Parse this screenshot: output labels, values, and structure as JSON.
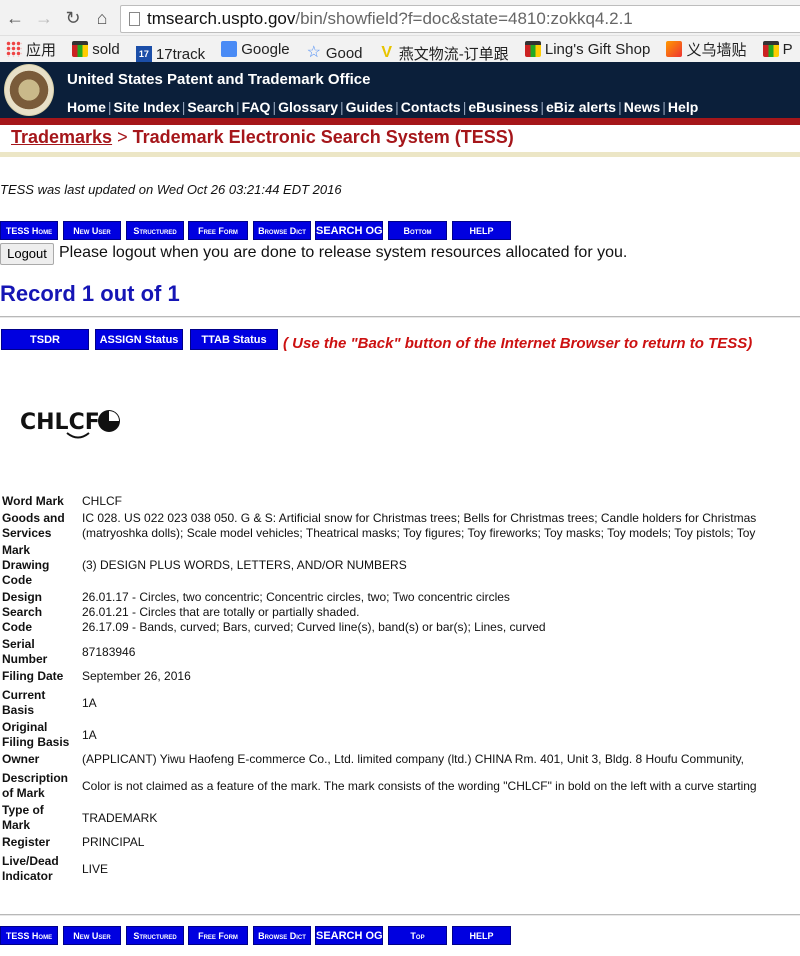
{
  "browser": {
    "url_host": "tmsearch.uspto.gov",
    "url_path": "/bin/showfield?f=doc&state=4810:zokkq4.2.1",
    "bookmarks": [
      {
        "icon": "apps-icon",
        "label": "应用"
      },
      {
        "icon": "shopping-bag-icon",
        "label": "sold"
      },
      {
        "icon": "17track-icon",
        "label": "17track"
      },
      {
        "icon": "google-icon",
        "label": "Google"
      },
      {
        "icon": "star-icon",
        "label": "Good"
      },
      {
        "icon": "yanwen-icon",
        "label": "燕文物流-订单跟"
      },
      {
        "icon": "shopping-bag-icon",
        "label": "Ling's Gift Shop"
      },
      {
        "icon": "flame-icon",
        "label": "义乌墙贴"
      },
      {
        "icon": "shopping-bag-icon",
        "label": "P"
      }
    ]
  },
  "header": {
    "agency": "United States Patent and Trademark Office",
    "nav": [
      "Home",
      "Site Index",
      "Search",
      "FAQ",
      "Glossary",
      "Guides",
      "Contacts",
      "eBusiness",
      "eBiz alerts",
      "News",
      "Help"
    ],
    "breadcrumb_link": "Trademarks",
    "breadcrumb_sep": ">",
    "breadcrumb_title": "Trademark Electronic Search System (TESS)"
  },
  "status": {
    "updated": "TESS was last updated on Wed Oct 26 03:21:44 EDT 2016"
  },
  "top_buttons": [
    "TESS Home",
    "New User",
    "Structured",
    "Free Form",
    "Browse Dict",
    "SEARCH OG",
    "Bottom",
    "HELP"
  ],
  "bottom_buttons": [
    "TESS Home",
    "New User",
    "Structured",
    "Free Form",
    "Browse Dict",
    "SEARCH OG",
    "Top",
    "HELP"
  ],
  "logout": {
    "button": "Logout",
    "message": "Please logout when you are done to release system resources allocated for you."
  },
  "record": {
    "title": "Record 1 out of 1",
    "status_buttons": [
      "TSDR",
      "ASSIGN Status",
      "TTAB Status"
    ],
    "back_note": "( Use the \"Back\" button of the Internet Browser to return to TESS)",
    "mark_text": "CHLCF"
  },
  "details": {
    "word_mark": {
      "label": "Word Mark",
      "value": "CHLCF"
    },
    "goods_services": {
      "label1": "Goods and",
      "label2": "Services",
      "line1": "IC 028. US 022 023 038 050. G & S: Artificial snow for Christmas trees; Bells for Christmas trees; Candle holders for Christmas",
      "line2": "(matryoshka dolls); Scale model vehicles; Theatrical masks; Toy figures; Toy fireworks; Toy masks; Toy models; Toy pistols; Toy"
    },
    "drawing_code": {
      "label1": "Mark",
      "label2": "Drawing",
      "label3": "Code",
      "value": "(3) DESIGN PLUS WORDS, LETTERS, AND/OR NUMBERS"
    },
    "design_code": {
      "label1": "Design",
      "label2": "Search",
      "label3": "Code",
      "line1": "26.01.17 - Circles, two concentric; Concentric circles, two; Two concentric circles",
      "line2": "26.01.21 - Circles that are totally or partially shaded.",
      "line3": "26.17.09 - Bands, curved; Bars, curved; Curved line(s), band(s) or bar(s); Lines, curved"
    },
    "serial": {
      "label1": "Serial",
      "label2": "Number",
      "value": "87183946"
    },
    "filing_date": {
      "label": "Filing Date",
      "value": "September 26, 2016"
    },
    "current_basis": {
      "label1": "Current",
      "label2": "Basis",
      "value": "1A"
    },
    "original_basis": {
      "label1": "Original",
      "label2": "Filing Basis",
      "value": "1A"
    },
    "owner": {
      "label": "Owner",
      "value": "(APPLICANT) Yiwu Haofeng E-commerce Co., Ltd. limited company (ltd.) CHINA Rm. 401, Unit 3, Bldg. 8 Houfu Community,"
    },
    "description": {
      "label1": "Description",
      "label2": "of Mark",
      "value": "Color is not claimed as a feature of the mark. The mark consists of the wording \"CHLCF\" in bold on the left with a curve starting"
    },
    "type_of_mark": {
      "label1": "Type of",
      "label2": "Mark",
      "value": "TRADEMARK"
    },
    "register": {
      "label": "Register",
      "value": "PRINCIPAL"
    },
    "live_dead": {
      "label1": "Live/Dead",
      "label2": "Indicator",
      "value": "LIVE"
    }
  }
}
